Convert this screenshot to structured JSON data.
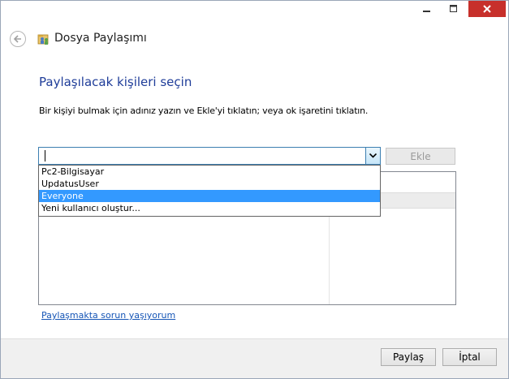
{
  "window": {
    "title": "Dosya Paylaşımı",
    "controls": {
      "minimize": "minimize-icon",
      "maximize": "maximize-icon",
      "close": "close-icon"
    }
  },
  "main": {
    "heading": "Paylaşılacak kişileri seçin",
    "instruction": "Bir kişiyi bulmak için adınız yazın ve Ekle'yi tıklatın; veya ok işaretini tıklatın.",
    "combo": {
      "value": ""
    },
    "add_label": "Ekle",
    "dropdown": {
      "items": [
        "Pc2-Bilgisayar",
        "UpdatusUser",
        "Everyone",
        "Yeni kullanıcı oluştur..."
      ],
      "selected": "Everyone"
    },
    "trouble_link": "Paylaşmakta sorun yaşıyorum"
  },
  "footer": {
    "share_label": "Paylaş",
    "cancel_label": "İptal"
  },
  "colors": {
    "accent_heading": "#1f3d99",
    "selection": "#3399ff",
    "close_button": "#c7302b",
    "link": "#1555b6"
  }
}
